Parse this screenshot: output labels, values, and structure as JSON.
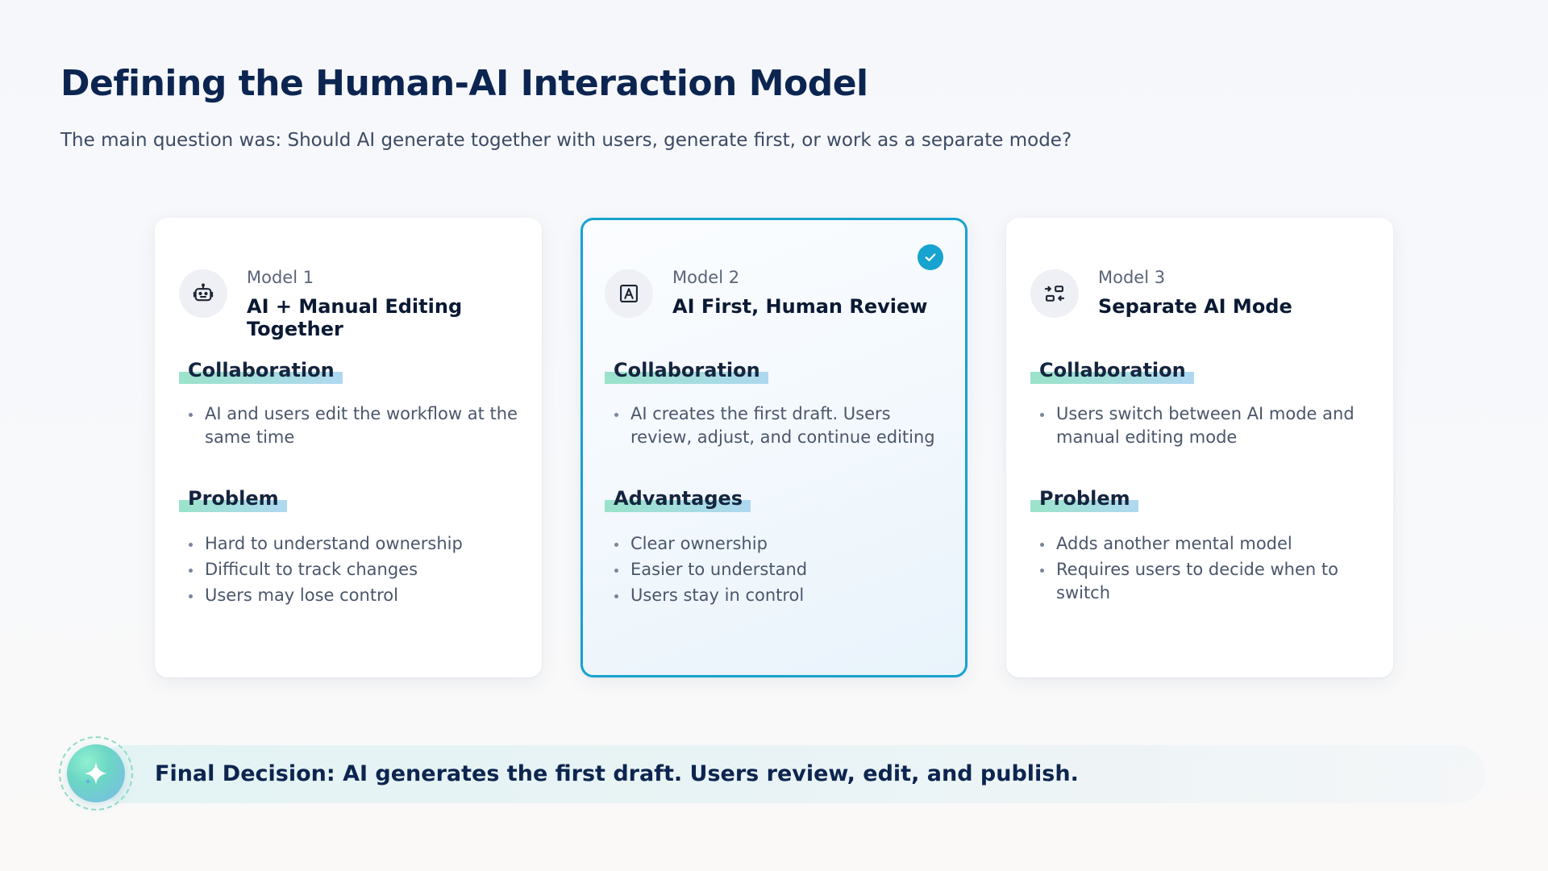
{
  "header": {
    "title": "Defining the Human-AI Interaction Model",
    "subtitle": "The main question was: Should AI generate together with users, generate first, or work as a separate mode?"
  },
  "colors": {
    "accent": "#16a3cf",
    "title": "#0c2550",
    "highlight_start": "#8fe0c4",
    "highlight_end": "#a6d4ef"
  },
  "models": [
    {
      "number": "Model 1",
      "name": "AI + Manual Editing Together",
      "icon": "robot-icon",
      "selected": false,
      "section1_label": "Collaboration",
      "section1_items": [
        "AI and users edit the workflow at the same time"
      ],
      "section2_label": "Problem",
      "section2_items": [
        "Hard to understand ownership",
        "Difficult to track changes",
        "Users may lose control"
      ]
    },
    {
      "number": "Model 2",
      "name": "AI First, Human Review",
      "icon": "ai-document-icon",
      "selected": true,
      "section1_label": "Collaboration",
      "section1_items": [
        "AI creates the first draft. Users review, adjust, and continue editing"
      ],
      "section2_label": "Advantages",
      "section2_items": [
        "Clear ownership",
        "Easier to understand",
        "Users stay in control"
      ]
    },
    {
      "number": "Model 3",
      "name": "Separate AI Mode",
      "icon": "switch-mode-icon",
      "selected": false,
      "section1_label": "Collaboration",
      "section1_items": [
        "Users switch between AI mode and manual editing mode"
      ],
      "section2_label": "Problem",
      "section2_items": [
        "Adds another mental model",
        "Requires users to decide when to switch"
      ]
    }
  ],
  "decision": {
    "text": "Final Decision: AI generates the first draft. Users review, edit, and publish.",
    "icon": "sparkle-icon"
  }
}
